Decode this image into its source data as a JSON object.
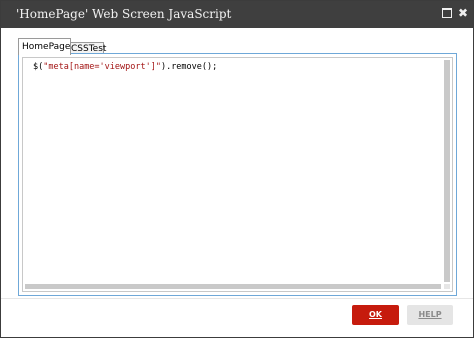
{
  "window": {
    "title": "'HomePage' Web Screen JavaScript",
    "maximize_icon": "maximize-icon",
    "close_icon": "close-icon",
    "close_glyph": "✖"
  },
  "tabs": [
    {
      "label": "HomePage",
      "active": true
    },
    {
      "label": "CSSTest",
      "active": false
    }
  ],
  "editor": {
    "code_prefix": "$(",
    "code_string": "\"meta[name='viewport']\"",
    "code_suffix": ").remove();"
  },
  "buttons": {
    "ok_label": "OK",
    "help_label": "HELP"
  },
  "colors": {
    "titlebar": "#3f3f3f",
    "ok_button": "#c61b0d",
    "help_button": "#e5e5e5",
    "editor_border": "#6fa8d8"
  }
}
